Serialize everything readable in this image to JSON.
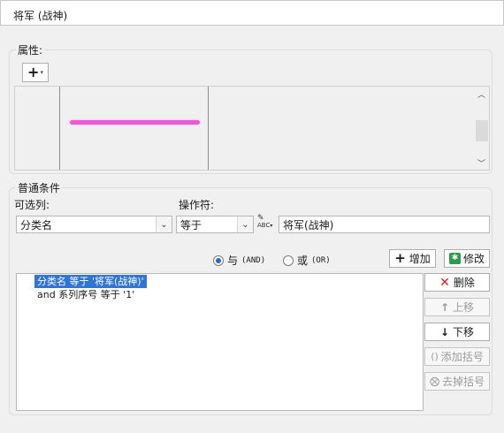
{
  "window": {
    "title": "将军 (战神)"
  },
  "properties": {
    "group_label": "属性:",
    "add_icon": "plus-icon",
    "line_color": "#e95ad3"
  },
  "conditions": {
    "group_label": "普通条件",
    "selectable_column_label": "可选列:",
    "selectable_column_value": "分类名",
    "operator_label": "操作符:",
    "operator_value": "等于",
    "value_input": "将军(战神)",
    "radio_and_label": "与",
    "radio_and_code": "(AND)",
    "radio_or_label": "或",
    "radio_or_code": "(OR)",
    "selected_radio": "and",
    "add_button": "增加",
    "modify_button": "修改",
    "condition_list": [
      "分类名 等于 '将军(战神)'",
      "and 系列序号 等于 '1'"
    ],
    "delete_button": "删除",
    "move_up_button": "上移",
    "move_down_button": "下移",
    "add_bracket_button": "添加括号",
    "remove_bracket_button": "去掉括号"
  }
}
